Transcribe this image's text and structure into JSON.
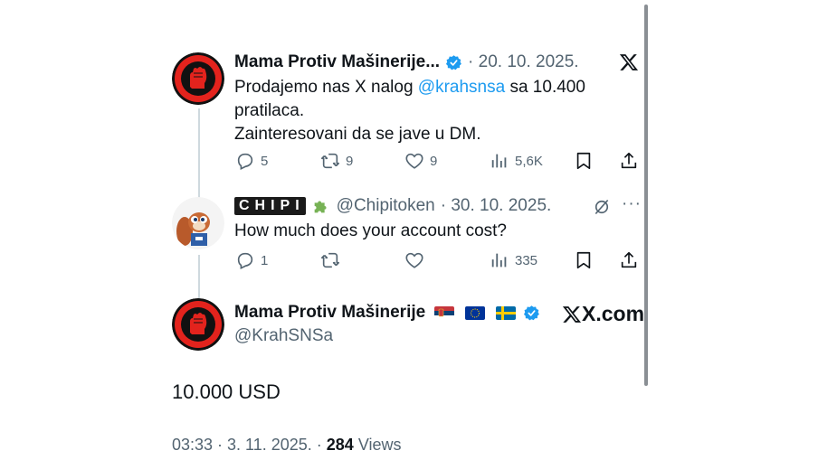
{
  "tweet1": {
    "name": "Mama Protiv Mašinerije...",
    "date": "· 20. 10. 2025.",
    "text_line1_a": "Prodajemo nas X nalog ",
    "mention": "@krahsnsa",
    "text_line1_b": " sa 10.400",
    "text_line2": "pratilaca.",
    "text_line3": "Zainteresovani da se jave  u DM.",
    "replies": "5",
    "retweets": "9",
    "likes": "9",
    "views": "5,6K",
    "avatar_text": "mama protiv mašinerije"
  },
  "tweet2": {
    "name": "CHIPI",
    "handle": "@Chipitoken",
    "date": "· 30. 10. 2025.",
    "text": "How much does your account cost?",
    "replies": "1",
    "retweets": "",
    "likes": "",
    "views": "335",
    "more": "···"
  },
  "main": {
    "name": "Mama Protiv Mašinerije",
    "handle": "@KrahSNSa",
    "brand": "X.com",
    "text": "10.000 USD",
    "time": "03:33 · 3. 11. 2025. · ",
    "views_count": "284",
    "views_label": " Views"
  },
  "colors": {
    "accent": "#1d9bf0",
    "muted": "#536471",
    "logo_red": "#e3231d",
    "logo_dark": "#111111"
  },
  "icons": [
    "x-logo-icon",
    "verified-badge-icon",
    "reply-icon",
    "retweet-icon",
    "like-icon",
    "views-icon",
    "bookmark-icon",
    "share-icon",
    "puzzle-icon",
    "serbia-flag-icon",
    "eu-flag-icon",
    "sweden-flag-icon"
  ]
}
